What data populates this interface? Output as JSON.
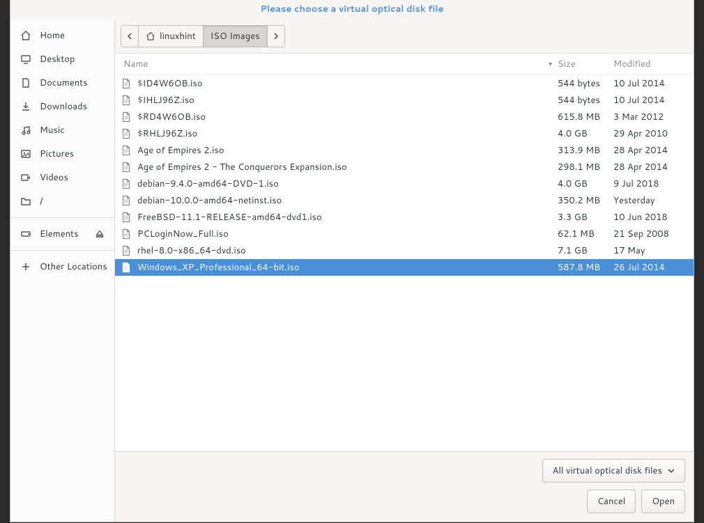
{
  "title": "Please choose a virtual optical disk file",
  "sidebar": {
    "items": [
      {
        "label": "Home"
      },
      {
        "label": "Desktop"
      },
      {
        "label": "Documents"
      },
      {
        "label": "Downloads"
      },
      {
        "label": "Music"
      },
      {
        "label": "Pictures"
      },
      {
        "label": "Videos"
      },
      {
        "label": "/"
      }
    ],
    "elements_label": "Elements",
    "other_locations_label": "Other Locations"
  },
  "pathbar": {
    "crumb_home": "linuxhint",
    "crumb_current": "ISO Images"
  },
  "columns": {
    "name": "Name",
    "size": "Size",
    "modified": "Modified"
  },
  "files": [
    {
      "name": "$ID4W6OB.iso",
      "size": "544 bytes",
      "modified": "10 Jul 2014",
      "selected": false
    },
    {
      "name": "$IHLJ96Z.iso",
      "size": "544 bytes",
      "modified": "10 Jul 2014",
      "selected": false
    },
    {
      "name": "$RD4W6OB.iso",
      "size": "615.8 MB",
      "modified": "3 Mar 2012",
      "selected": false
    },
    {
      "name": "$RHLJ96Z.iso",
      "size": "4.0 GB",
      "modified": "29 Apr 2010",
      "selected": false
    },
    {
      "name": "Age of Empires 2.iso",
      "size": "313.9 MB",
      "modified": "28 Apr 2014",
      "selected": false
    },
    {
      "name": "Age of Empires 2 - The Conquerors Expansion.iso",
      "size": "298.1 MB",
      "modified": "28 Apr 2014",
      "selected": false
    },
    {
      "name": "debian-9.4.0-amd64-DVD-1.iso",
      "size": "4.0 GB",
      "modified": "9 Jul 2018",
      "selected": false
    },
    {
      "name": "debian-10.0.0-amd64-netinst.iso",
      "size": "350.2 MB",
      "modified": "Yesterday",
      "selected": false
    },
    {
      "name": "FreeBSD-11.1-RELEASE-amd64-dvd1.iso",
      "size": "3.3 GB",
      "modified": "10 Jun 2018",
      "selected": false
    },
    {
      "name": "PCLoginNow_Full.iso",
      "size": "62.1 MB",
      "modified": "21 Sep 2008",
      "selected": false
    },
    {
      "name": "rhel-8.0-x86_64-dvd.iso",
      "size": "7.1 GB",
      "modified": "17 May",
      "selected": false
    },
    {
      "name": "Windows_XP_Professional_64-bit.iso",
      "size": "587.8 MB",
      "modified": "26 Jul 2014",
      "selected": true
    }
  ],
  "footer": {
    "filter_label": "All virtual optical disk files",
    "cancel_label": "Cancel",
    "open_label": "Open"
  }
}
